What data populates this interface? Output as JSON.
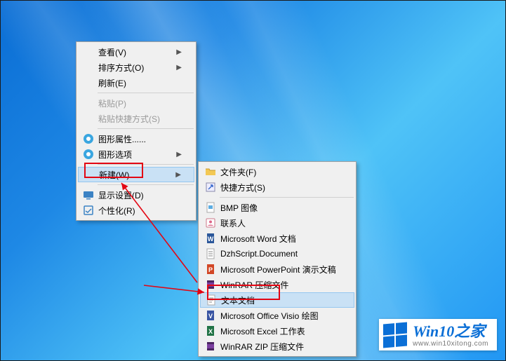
{
  "context_menu": {
    "items": [
      {
        "label": "查看(V)",
        "arrow": true,
        "icon": null
      },
      {
        "label": "排序方式(O)",
        "arrow": true,
        "icon": null
      },
      {
        "label": "刷新(E)",
        "arrow": false,
        "icon": null
      },
      {
        "sep": true
      },
      {
        "label": "粘贴(P)",
        "arrow": false,
        "disabled": true,
        "icon": null
      },
      {
        "label": "粘贴快捷方式(S)",
        "arrow": false,
        "disabled": true,
        "icon": null
      },
      {
        "sep": true
      },
      {
        "label": "图形属性......",
        "arrow": false,
        "icon": "intel"
      },
      {
        "label": "图形选项",
        "arrow": true,
        "icon": "intel"
      },
      {
        "sep": true
      },
      {
        "label": "新建(W)",
        "arrow": true,
        "hover": true,
        "icon": null
      },
      {
        "sep": true
      },
      {
        "label": "显示设置(D)",
        "arrow": false,
        "icon": "display"
      },
      {
        "label": "个性化(R)",
        "arrow": false,
        "icon": "personalize"
      }
    ]
  },
  "new_submenu": {
    "items": [
      {
        "label": "文件夹(F)",
        "icon": "folder"
      },
      {
        "label": "快捷方式(S)",
        "icon": "shortcut"
      },
      {
        "sep": true
      },
      {
        "label": "BMP 图像",
        "icon": "bmp"
      },
      {
        "label": "联系人",
        "icon": "contact"
      },
      {
        "label": "Microsoft Word 文档",
        "icon": "word"
      },
      {
        "label": "DzhScript.Document",
        "icon": "doc"
      },
      {
        "label": "Microsoft PowerPoint 演示文稿",
        "icon": "ppt"
      },
      {
        "label": "WinRAR 压缩文件",
        "icon": "rar"
      },
      {
        "label": "文本文档",
        "icon": "txt",
        "hover": true
      },
      {
        "label": "Microsoft Office Visio 绘图",
        "icon": "visio"
      },
      {
        "label": "Microsoft Excel 工作表",
        "icon": "excel"
      },
      {
        "label": "WinRAR ZIP 压缩文件",
        "icon": "rar"
      }
    ]
  },
  "watermark": {
    "title_main": "Win10",
    "title_suffix": "之家",
    "url": "www.win10xitong.com"
  }
}
